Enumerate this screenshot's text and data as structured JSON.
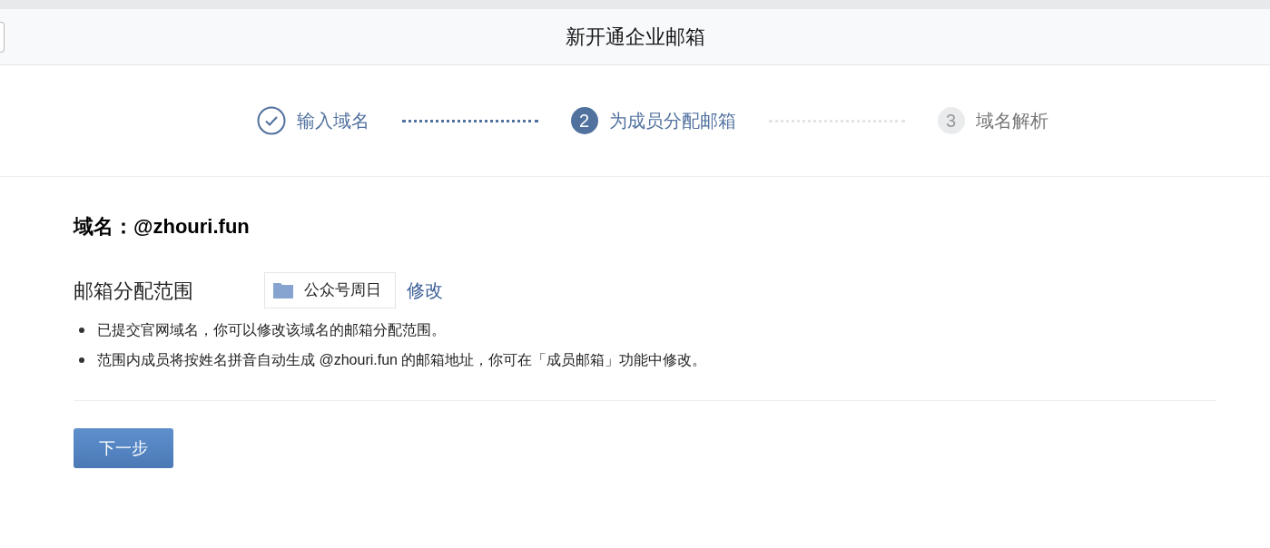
{
  "header": {
    "title": "新开通企业邮箱"
  },
  "steps": [
    {
      "kind": "done",
      "label": "输入域名"
    },
    {
      "kind": "current",
      "number": "2",
      "label": "为成员分配邮箱"
    },
    {
      "kind": "pending",
      "number": "3",
      "label": "域名解析"
    }
  ],
  "domain": {
    "text": "域名：@zhouri.fun"
  },
  "scope": {
    "label": "邮箱分配范围",
    "department": "公众号周日",
    "edit_link": "修改"
  },
  "notes": [
    "已提交官网域名，你可以修改该域名的邮箱分配范围。",
    "范围内成员将按姓名拼音自动生成 @zhouri.fun 的邮箱地址，你可在「成员邮箱」功能中修改。"
  ],
  "next_button": "下一步"
}
